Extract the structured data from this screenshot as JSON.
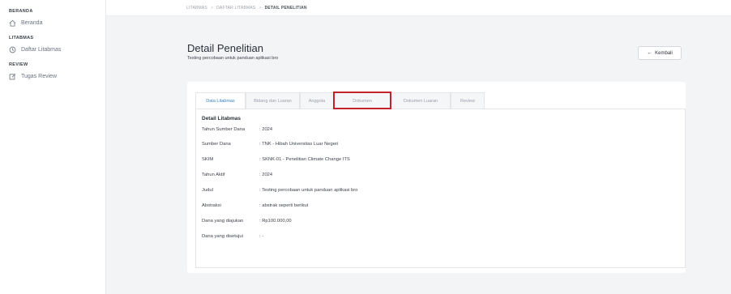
{
  "sidebar": {
    "sections": [
      {
        "title": "BERANDA",
        "items": [
          {
            "label": "Beranda",
            "icon": "home-icon"
          }
        ]
      },
      {
        "title": "LITABMAS",
        "items": [
          {
            "label": "Daftar Litabmas",
            "icon": "clock-icon"
          }
        ]
      },
      {
        "title": "REVIEW",
        "items": [
          {
            "label": "Tugas Review",
            "icon": "edit-icon"
          }
        ]
      }
    ]
  },
  "breadcrumb": {
    "items": [
      "LITABMAS",
      "DAFTAR LITABMAS",
      "DETAIL PENELITIAN"
    ],
    "separator": ">"
  },
  "header": {
    "title": "Detail Penelitian",
    "subtitle": "Testing percobaan untuk panduan aplikasi bro",
    "back_label": "Kembali"
  },
  "tabs": [
    {
      "label": "Data Litabmas",
      "active": true
    },
    {
      "label": "Bidang dan Luaran",
      "active": false
    },
    {
      "label": "Anggota",
      "active": false
    },
    {
      "label": "Dokumen",
      "active": false,
      "highlighted": true
    },
    {
      "label": "Dokumen Luaran",
      "active": false
    },
    {
      "label": "Review",
      "active": false
    }
  ],
  "detail": {
    "title": "Detail Litabmas",
    "rows": [
      {
        "label": "Tahun Sumber Dana",
        "value": ": 2024"
      },
      {
        "label": "Sumber Dana",
        "value": ": TNK - Hibah Universitas Luar Negeri"
      },
      {
        "label": "SKIM",
        "value": ": SKNK-01 - Penelitian Climate Change ITS"
      },
      {
        "label": "Tahun Aktif",
        "value": ": 2024"
      },
      {
        "label": "Judul",
        "value": ": Testing percobaan untuk panduan aplikasi bro"
      },
      {
        "label": "Abstraksi",
        "value": ": abstrak seperti berikut"
      },
      {
        "label": "Dana yang diajukan",
        "value": ": Rp100.000,00"
      },
      {
        "label": "Dana yang disetujui",
        "value": ": -"
      }
    ]
  },
  "colors": {
    "accent": "#3b82c4",
    "highlight": "#c0232b",
    "background": "#f3f4f6"
  }
}
